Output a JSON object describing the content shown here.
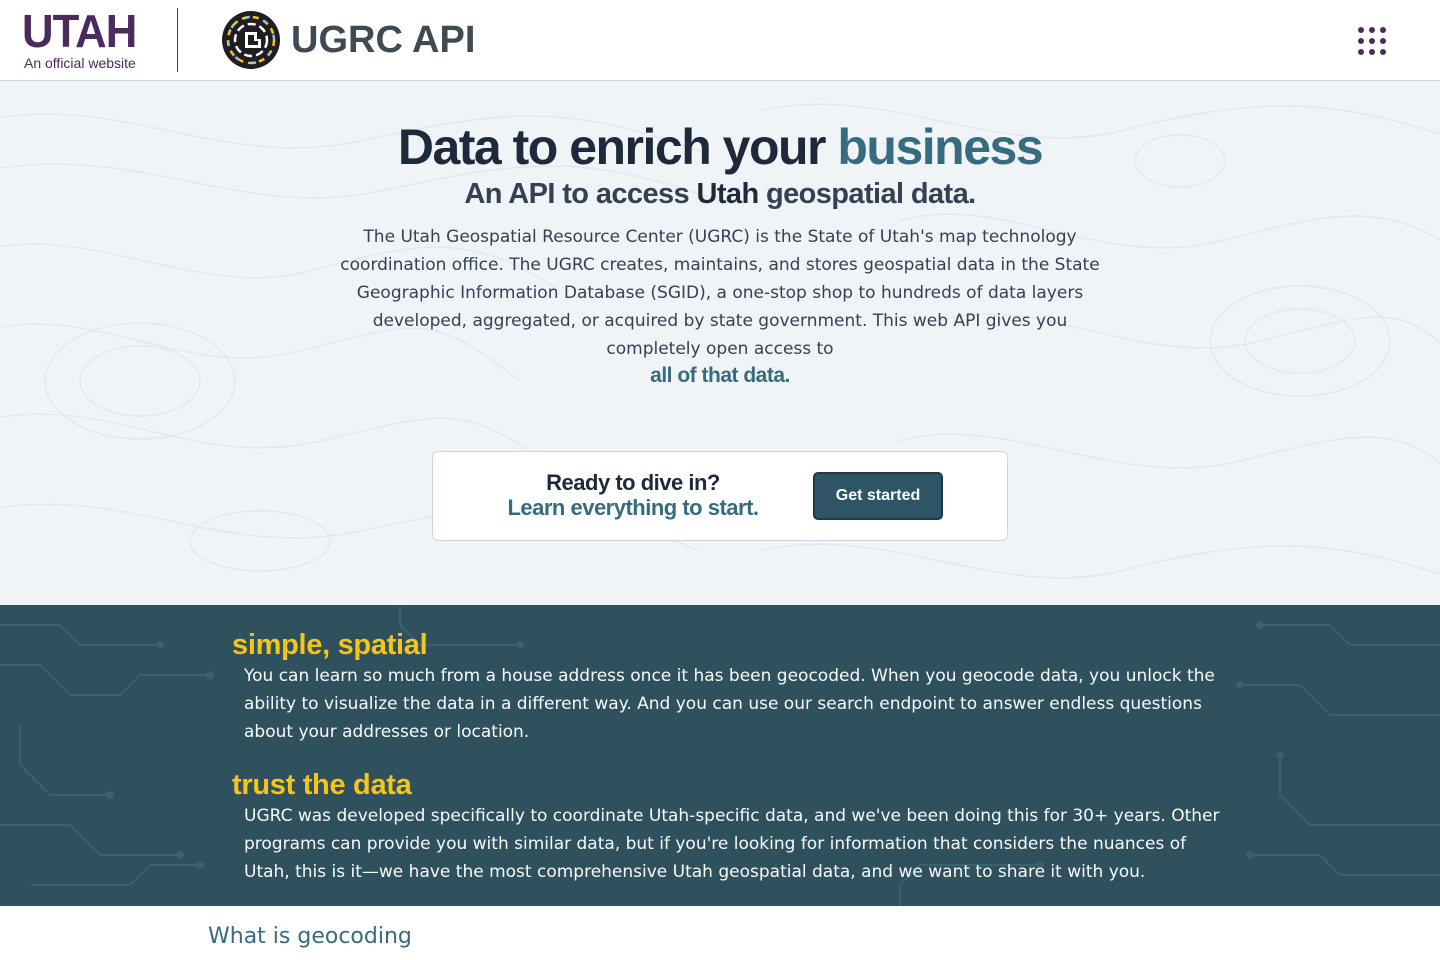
{
  "header": {
    "brand": "UTAH",
    "brand_sub": "An official website",
    "app_title": "UGRC API",
    "apps_icon": "grid-dots-icon"
  },
  "hero": {
    "title_part1": "Data to enrich your ",
    "title_accent": "business",
    "subtitle_part1": "An API to access ",
    "subtitle_bold": "Utah",
    "subtitle_part2": " geospatial data.",
    "body": "The Utah Geospatial Resource Center (UGRC) is the State of Utah's map technology coordination office. The UGRC creates, maintains, and stores geospatial data in the State Geographic Information Database (SGID), a one-stop shop to hundreds of data layers developed, aggregated, or acquired by state government. This web API gives you completely open access to",
    "link": "all of that data."
  },
  "cta": {
    "line1": "Ready to dive in?",
    "line2": "Learn everything to start.",
    "button": "Get started"
  },
  "features": [
    {
      "heading": "simple, spatial",
      "body": "You can learn so much from a house address once it has been geocoded. When you geocode data, you unlock the ability to visualize the data in a different way. And you can use our search endpoint to answer endless questions about your addresses or location."
    },
    {
      "heading": "trust the data",
      "body": "UGRC was developed specifically to coordinate Utah-specific data, and we've been doing this for 30+ years. Other programs can provide you with similar data, but if you're looking for information that considers the nuances of Utah, this is it—we have the most comprehensive Utah geospatial data, and we want to share it with you."
    }
  ],
  "next_section": "What is geocoding",
  "colors": {
    "utah_purple": "#4b2a5c",
    "accent_teal": "#376b7f",
    "feature_bg": "#2f505d",
    "feature_heading": "#f5c518"
  }
}
